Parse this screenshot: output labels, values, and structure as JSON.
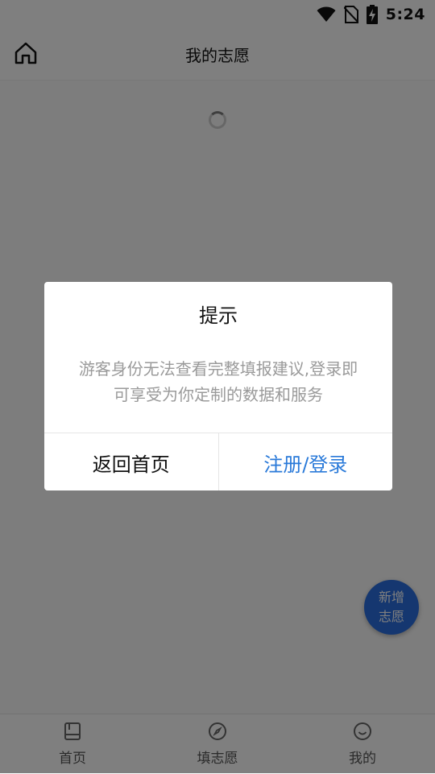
{
  "status_bar": {
    "time": "5:24",
    "icons": [
      "wifi-icon",
      "no-sim-icon",
      "battery-charging-icon"
    ]
  },
  "header": {
    "title": "我的志愿",
    "home_icon": "home-icon"
  },
  "content": {
    "loading": true,
    "fab": {
      "line1": "新增",
      "line2": "志愿",
      "color": "#2a6fe0"
    }
  },
  "bottom_nav": {
    "items": [
      {
        "label": "首页",
        "icon": "book-icon"
      },
      {
        "label": "填志愿",
        "icon": "compass-icon"
      },
      {
        "label": "我的",
        "icon": "smile-icon"
      }
    ]
  },
  "dialog": {
    "title": "提示",
    "message": "游客身份无法查看完整填报建议,登录即可享受为你定制的数据和服务",
    "cancel_label": "返回首页",
    "confirm_label": "注册/登录",
    "confirm_color": "#2a7ad9"
  }
}
